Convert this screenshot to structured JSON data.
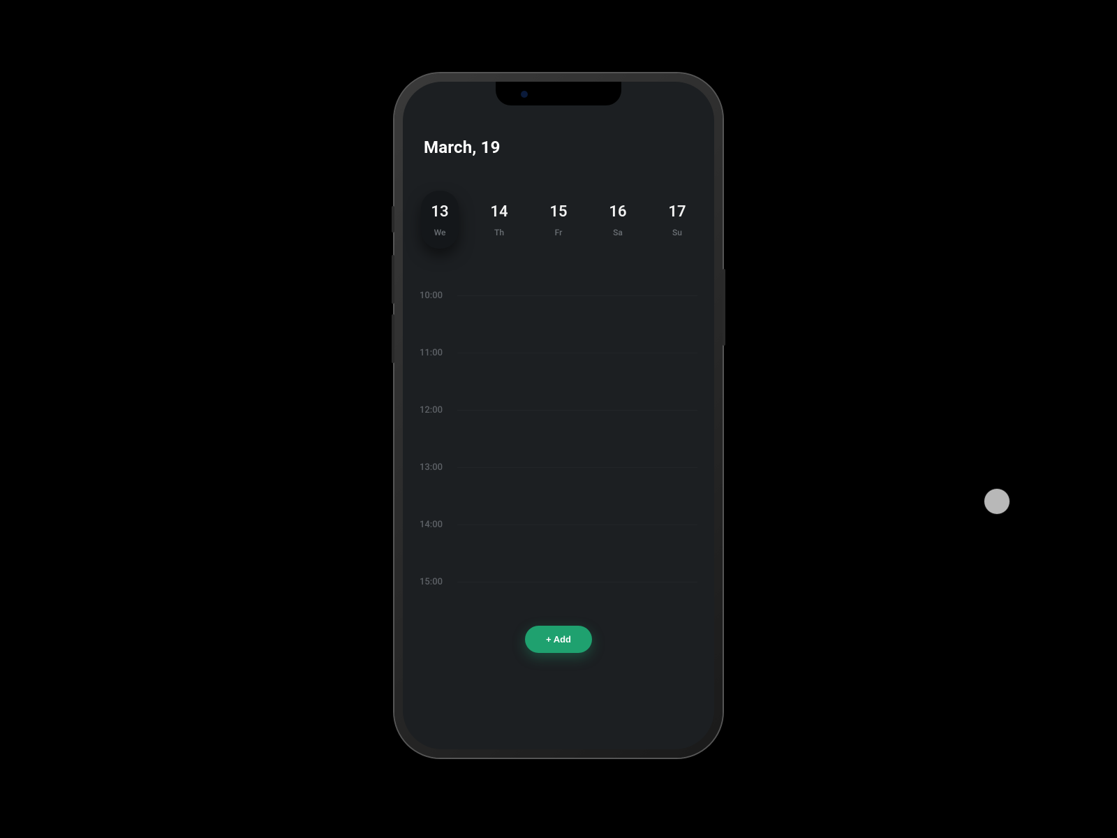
{
  "header": {
    "title": "March, 19"
  },
  "days": [
    {
      "num": "13",
      "abbr": "We",
      "selected": true
    },
    {
      "num": "14",
      "abbr": "Th",
      "selected": false
    },
    {
      "num": "15",
      "abbr": "Fr",
      "selected": false
    },
    {
      "num": "16",
      "abbr": "Sa",
      "selected": false
    },
    {
      "num": "17",
      "abbr": "Su",
      "selected": false
    }
  ],
  "timeline": {
    "slots": [
      "10:00",
      "11:00",
      "12:00",
      "13:00",
      "14:00",
      "15:00"
    ]
  },
  "actions": {
    "add_label": "+ Add"
  },
  "colors": {
    "accent": "#1fa16f",
    "screen_bg": "#1c1f22"
  }
}
